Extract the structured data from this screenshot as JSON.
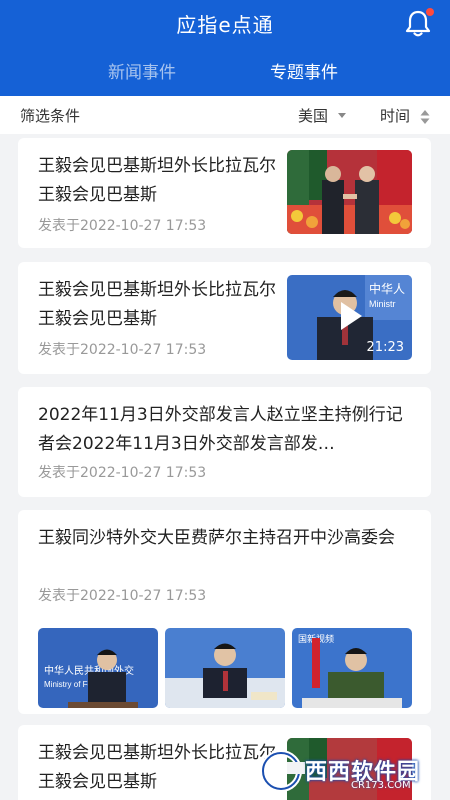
{
  "header": {
    "app_title": "应指e点通",
    "tabs": [
      {
        "label": "新闻事件",
        "active": false
      },
      {
        "label": "专题事件",
        "active": true
      }
    ],
    "bell_icon": "bell-icon",
    "accent_color": "#1561d6"
  },
  "filter": {
    "label": "筛选条件",
    "country": "美国",
    "time": "时间"
  },
  "cards": [
    {
      "title": "王毅会见巴基斯坦外长比拉瓦尔王毅会见巴基斯",
      "date": "发表于2022-10-27 17:53"
    },
    {
      "title": "王毅会见巴基斯坦外长比拉瓦尔王毅会见巴基斯",
      "date": "发表于2022-10-27 17:53",
      "video_duration": "21:23",
      "thumb_text": "中华人 Ministr"
    },
    {
      "title": "2022年11月3日外交部发言人赵立坚主持例行记者会2022年11月3日外交部发言部发…",
      "date": "发表于2022-10-27 17:53"
    },
    {
      "title": "王毅同沙特外交大臣费萨尔主持召开中沙高委会",
      "date": "发表于2022-10-27 17:53",
      "thumb_texts": [
        "中华人民共和国外交",
        "Ministry of Foreign Af",
        "国新视频"
      ]
    },
    {
      "title": "王毅会见巴基斯坦外长比拉瓦尔王毅会见巴基斯"
    }
  ],
  "watermark": {
    "text": "西西软件园",
    "sub": "CR173.COM"
  }
}
